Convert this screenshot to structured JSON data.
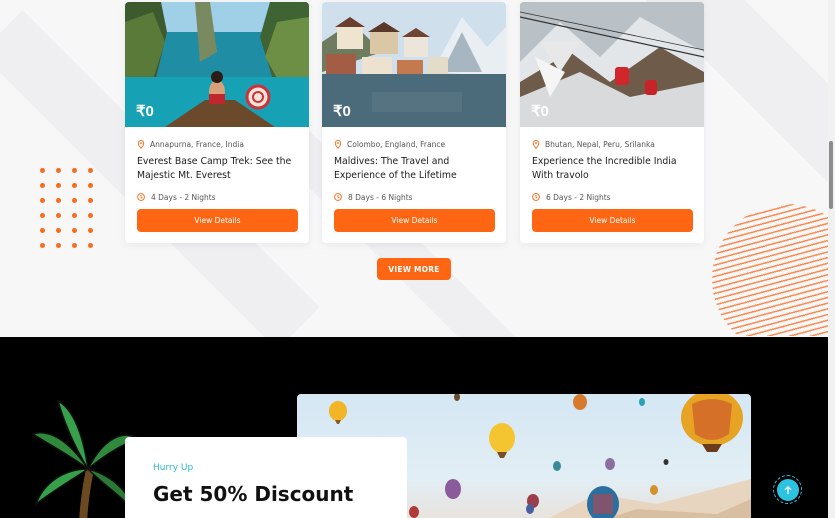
{
  "tours": [
    {
      "price": "₹0",
      "location": "Annapurna, France, India",
      "title": "Everest Base Camp Trek: See the Majestic Mt. Everest",
      "duration": "4 Days - 2 Nights",
      "button_label": "View Details",
      "image_icon": "boat-lagoon-photo"
    },
    {
      "price": "₹0",
      "location": "Colombo, England, France",
      "title": "Maldives: The Travel and Experience of the Lifetime",
      "duration": "8 Days - 6 Nights",
      "button_label": "View Details",
      "image_icon": "lakeside-village-photo"
    },
    {
      "price": "₹0",
      "location": "Bhutan, Nepal, Peru, Srilanka",
      "title": "Experience the Incredible India With travolo",
      "duration": "6 Days - 2 Nights",
      "button_label": "View Details",
      "image_icon": "cable-car-photo"
    }
  ],
  "view_more_label": "VIEW MORE",
  "promo": {
    "kicker": "Hurry Up",
    "title": "Get 50% Discount"
  },
  "colors": {
    "accent": "#ff6614",
    "teal": "#2bc3e0",
    "dark_section": "#000000"
  },
  "icons": {
    "location": "map-pin-icon",
    "duration": "clock-icon",
    "scroll_top": "arrow-up-icon"
  }
}
